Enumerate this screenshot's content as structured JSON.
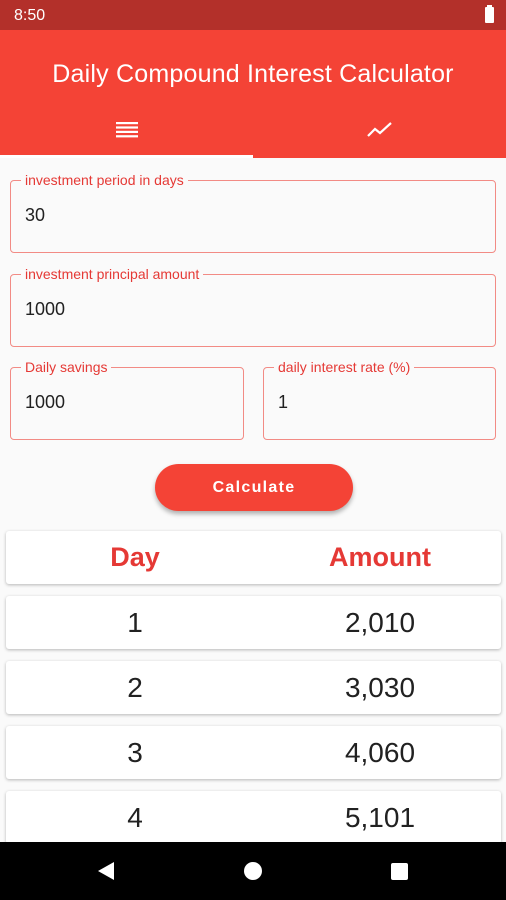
{
  "status_bar": {
    "time": "8:50",
    "icons": [
      "battery-icon"
    ]
  },
  "app_bar": {
    "title": "Daily Compound Interest Calculator",
    "tabs": [
      {
        "icon": "list-icon",
        "selected": true
      },
      {
        "icon": "chart-line-icon",
        "selected": false
      }
    ]
  },
  "form": {
    "investment_period": {
      "label": "investment period in days",
      "value": "30"
    },
    "principal": {
      "label": "investment principal amount",
      "value": "1000"
    },
    "daily_savings": {
      "label": "Daily savings",
      "value": "1000"
    },
    "daily_rate": {
      "label": "daily interest rate (%)",
      "value": "1"
    },
    "calculate_label": "Calculate"
  },
  "table": {
    "headers": {
      "day": "Day",
      "amount": "Amount"
    },
    "rows": [
      {
        "day": "1",
        "amount": "2,010"
      },
      {
        "day": "2",
        "amount": "3,030"
      },
      {
        "day": "3",
        "amount": "4,060"
      },
      {
        "day": "4",
        "amount": "5,101"
      }
    ]
  },
  "nav_bar": {
    "icons": [
      "back-icon",
      "home-icon",
      "recents-icon"
    ]
  },
  "colors": {
    "primary": "#f44336",
    "status_bar": "#b3302a",
    "accent_text": "#e53935"
  }
}
